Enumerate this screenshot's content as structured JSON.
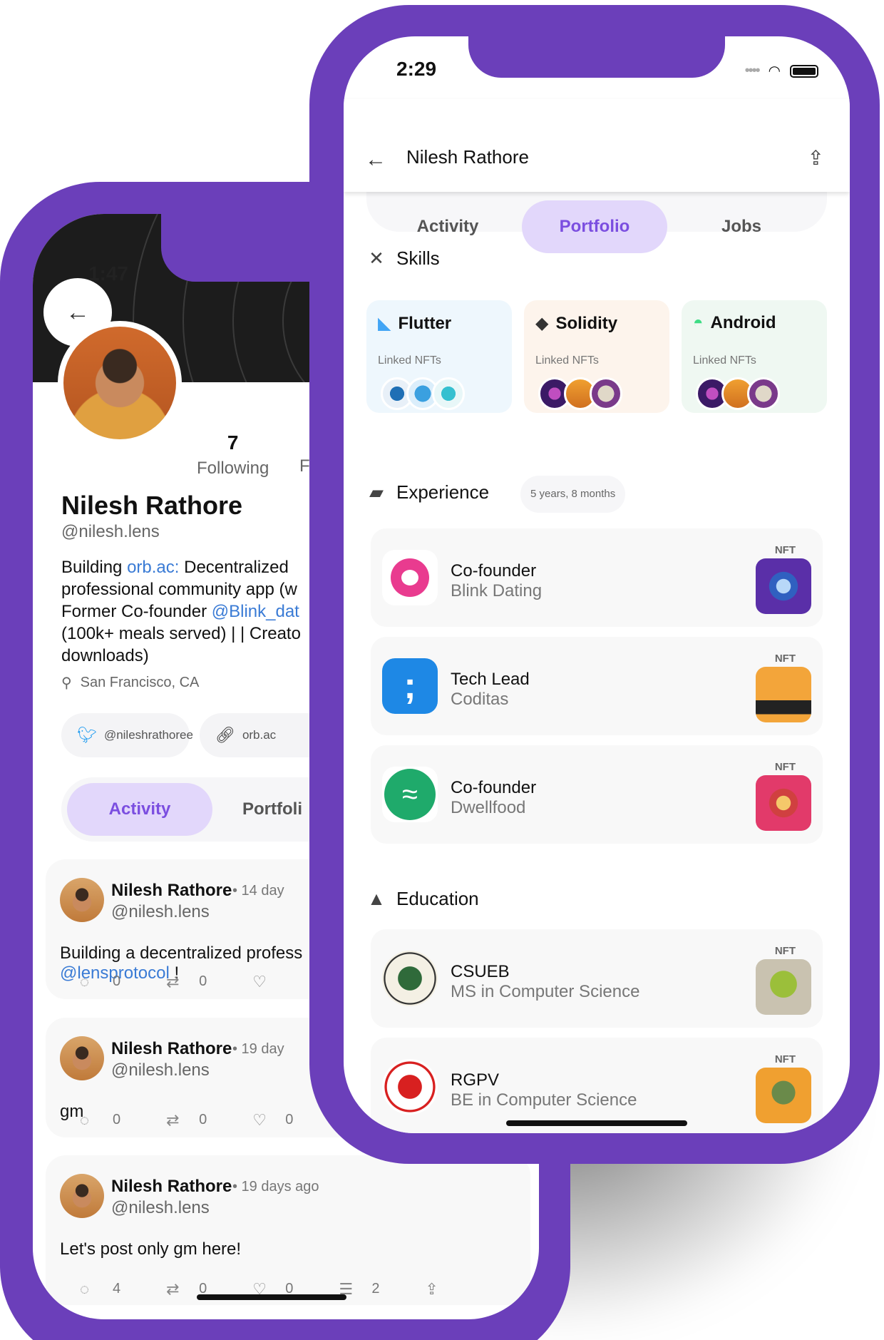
{
  "back_phone": {
    "time": "1:47",
    "following_count": "7",
    "following_label": "Following",
    "followers_label_partial": "Fo",
    "name": "Nilesh Rathore",
    "handle": "@nilesh.lens",
    "bio": {
      "part1": "Building ",
      "link1": "orb.ac:",
      "part2": " Decentralized ",
      "line2": "professional community app (w",
      "line3a": "Former Co-founder ",
      "link2": "@Blink_dat",
      "line4": "(100k+ meals served) | | Creato",
      "line5": "downloads)"
    },
    "location": "San Francisco, CA",
    "chips": [
      {
        "icon": "twitter-icon",
        "label": "@nileshrathoree"
      },
      {
        "icon": "link-icon",
        "label": "orb.ac"
      }
    ],
    "tabs": {
      "activity": "Activity",
      "portfolio": "Portfoli"
    },
    "posts": [
      {
        "name": "Nilesh Rathore",
        "time": "• 14 day",
        "handle": "@nilesh.lens",
        "text": "Building a decentralized profess",
        "link": "@lensprotocol",
        "after_link": " !",
        "comments": "0",
        "mirrors": "0",
        "likes": ""
      },
      {
        "name": "Nilesh Rathore",
        "time": "• 19 day",
        "handle": "@nilesh.lens",
        "text": "gm",
        "comments": "0",
        "mirrors": "0",
        "likes": "0"
      },
      {
        "name": "Nilesh Rathore",
        "time": "• 19 days ago",
        "handle": "@nilesh.lens",
        "text": "Let's post only gm here!",
        "comments": "4",
        "mirrors": "0",
        "likes": "0",
        "collects": "2"
      }
    ]
  },
  "front_phone": {
    "time": "2:29",
    "title": "Nilesh Rathore",
    "tabs": {
      "activity": "Activity",
      "portfolio": "Portfolio",
      "jobs": "Jobs",
      "active": "Portfolio"
    },
    "skills_heading": "Skills",
    "skills": [
      {
        "name": "Flutter",
        "linked_label": "Linked NFTs",
        "bg": "#eef7fd"
      },
      {
        "name": "Solidity",
        "linked_label": "Linked NFTs",
        "bg": "#fdf4ec"
      },
      {
        "name": "Android",
        "linked_label": "Linked NFTs",
        "bg": "#eff8f2"
      }
    ],
    "experience_heading": "Experience",
    "experience_duration": "5 years, 8 months",
    "experience": [
      {
        "title": "Co-founder",
        "company": "Blink Dating",
        "nft_label": "NFT"
      },
      {
        "title": "Tech Lead",
        "company": "Coditas",
        "nft_label": "NFT"
      },
      {
        "title": "Co-founder",
        "company": "Dwellfood",
        "nft_label": "NFT"
      }
    ],
    "education_heading": "Education",
    "education": [
      {
        "school": "CSUEB",
        "degree": "MS in Computer Science",
        "nft_label": "NFT"
      },
      {
        "school": "RGPV",
        "degree": "BE in Computer Science",
        "nft_label": "NFT"
      }
    ]
  },
  "colors": {
    "phone_frame": "#6b3fba",
    "accent": "#7b4ee0",
    "tab_pill": "#e2d7fb",
    "link": "#3a7bd5"
  }
}
